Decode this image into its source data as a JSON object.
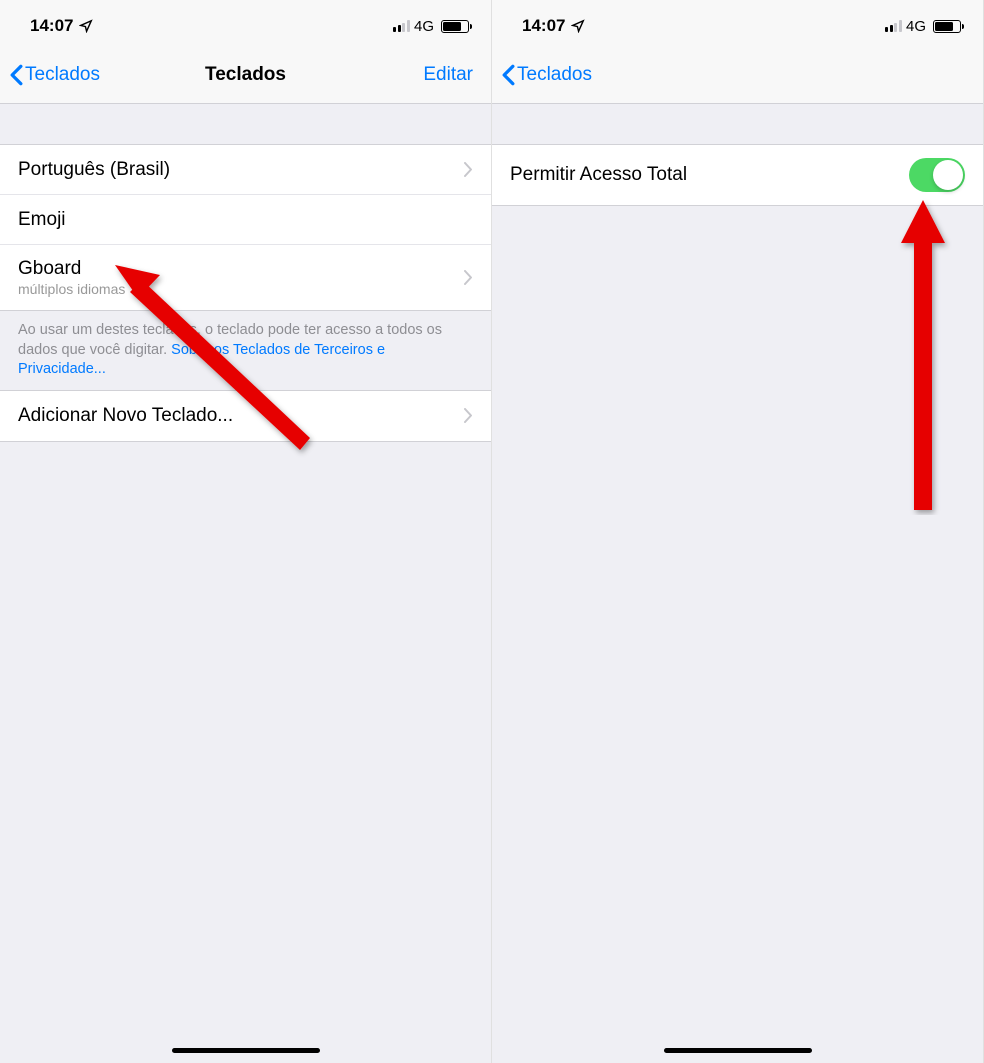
{
  "left_screen": {
    "status": {
      "time": "14:07",
      "network": "4G"
    },
    "nav": {
      "back_label": "Teclados",
      "title": "Teclados",
      "edit_label": "Editar"
    },
    "keyboards": [
      {
        "title": "Português (Brasil)",
        "subtitle": "",
        "has_chevron": true
      },
      {
        "title": "Emoji",
        "subtitle": "",
        "has_chevron": false
      },
      {
        "title": "Gboard",
        "subtitle": "múltiplos idiomas",
        "has_chevron": true
      }
    ],
    "footer": {
      "text_prefix": "Ao usar um destes teclados, o teclado pode ter acesso a todos os dados que você digitar. ",
      "link_text": "Sobre os Teclados de Terceiros e Privacidade..."
    },
    "add_keyboard": "Adicionar Novo Teclado..."
  },
  "right_screen": {
    "status": {
      "time": "14:07",
      "network": "4G"
    },
    "nav": {
      "back_label": "Teclados"
    },
    "setting": {
      "label": "Permitir Acesso Total",
      "toggle_on": true
    }
  }
}
